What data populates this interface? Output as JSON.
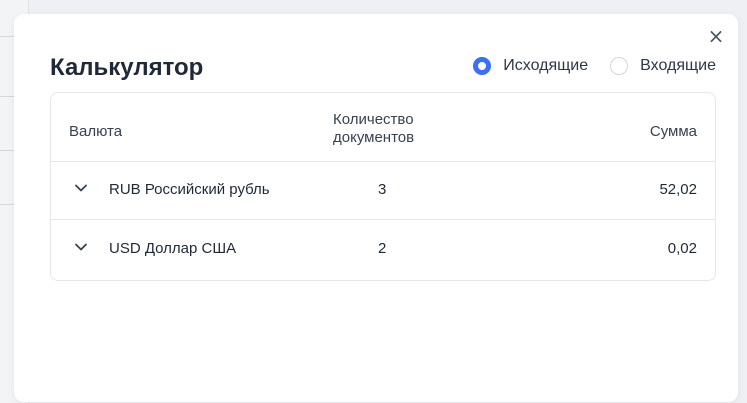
{
  "dialog": {
    "title": "Калькулятор",
    "close_symbol": "×",
    "radio_options": [
      {
        "label": "Исходящие",
        "checked": true
      },
      {
        "label": "Входящие",
        "checked": false
      }
    ],
    "accent_color": "#3b6ff5"
  },
  "table": {
    "headers": {
      "currency": "Валюта",
      "count_line1": "Количество",
      "count_line2": "документов",
      "sum": "Сумма"
    },
    "rows": [
      {
        "expand_icon": "chevron-down-icon",
        "currency": "RUB Российский рубль",
        "count": "3",
        "sum": "52,02"
      },
      {
        "expand_icon": "chevron-down-icon",
        "currency": "USD Доллар США",
        "count": "2",
        "sum": "0,02"
      }
    ]
  }
}
